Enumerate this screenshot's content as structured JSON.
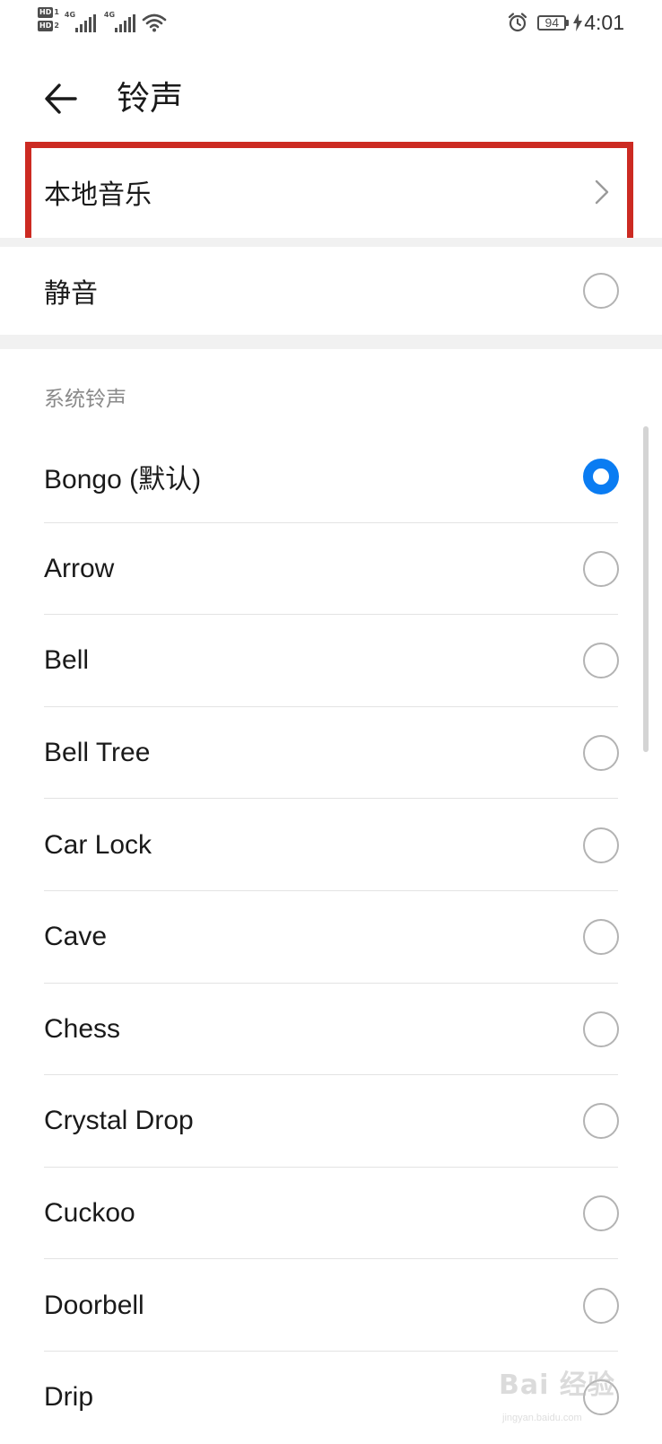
{
  "status_bar": {
    "hd_badges": [
      {
        "label": "HD",
        "index": "1"
      },
      {
        "label": "HD",
        "index": "2"
      }
    ],
    "signals": [
      {
        "network": "4G"
      },
      {
        "network": "4G"
      }
    ],
    "battery_level": "94",
    "time": "4:01"
  },
  "header": {
    "title": "铃声"
  },
  "local_music": {
    "label": "本地音乐"
  },
  "silent": {
    "label": "静音",
    "selected": false
  },
  "system_ringtones": {
    "section_title": "系统铃声",
    "items": [
      {
        "label": "Bongo (默认)",
        "selected": true
      },
      {
        "label": "Arrow",
        "selected": false
      },
      {
        "label": "Bell",
        "selected": false
      },
      {
        "label": "Bell Tree",
        "selected": false
      },
      {
        "label": "Car Lock",
        "selected": false
      },
      {
        "label": "Cave",
        "selected": false
      },
      {
        "label": "Chess",
        "selected": false
      },
      {
        "label": "Crystal Drop",
        "selected": false
      },
      {
        "label": "Cuckoo",
        "selected": false
      },
      {
        "label": "Doorbell",
        "selected": false
      },
      {
        "label": "Drip",
        "selected": false
      }
    ]
  },
  "colors": {
    "accent": "#0a7cf2",
    "highlight_border": "#cc2a22",
    "divider": "#e3e3e3",
    "section_gap": "#f1f1f1"
  },
  "watermark": {
    "text": "Bai 经验",
    "sub": "jingyan.baidu.com"
  }
}
